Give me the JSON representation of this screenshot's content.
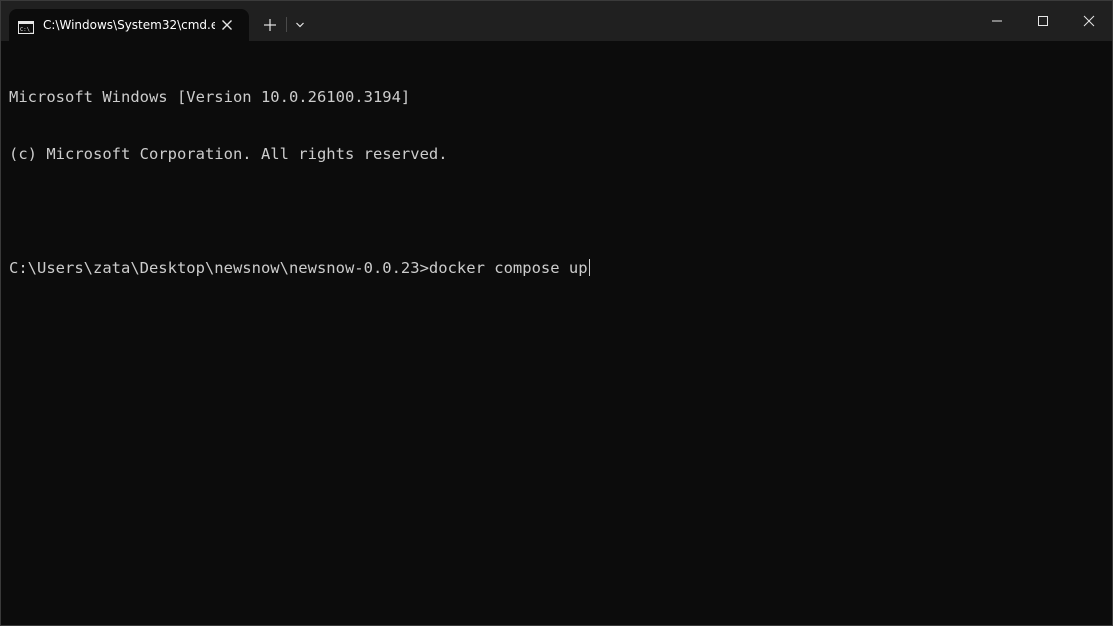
{
  "tab": {
    "title": "C:\\Windows\\System32\\cmd.e",
    "icon": "cmd-icon"
  },
  "tabbar": {
    "new_tab_icon": "plus-icon",
    "dropdown_icon": "chevron-down-icon"
  },
  "window_controls": {
    "minimize_icon": "minimize-icon",
    "maximize_icon": "maximize-icon",
    "close_icon": "close-icon"
  },
  "terminal": {
    "lines": [
      "Microsoft Windows [Version 10.0.26100.3194]",
      "(c) Microsoft Corporation. All rights reserved.",
      "",
      "C:\\Users\\zata\\Desktop\\newsnow\\newsnow-0.0.23>docker compose up"
    ]
  },
  "colors": {
    "background": "#0c0c0c",
    "titlebar": "#202020",
    "text": "#cccccc"
  }
}
